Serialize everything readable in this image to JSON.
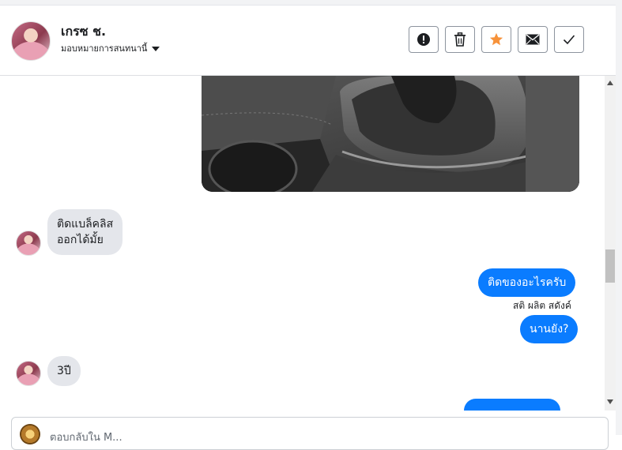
{
  "header": {
    "contact_name": "เกรซ ช.",
    "assign_label": "มอบหมายการสนทนานี้",
    "actions": [
      {
        "name": "report",
        "icon": "alert-circle-icon"
      },
      {
        "name": "delete",
        "icon": "trash-icon"
      },
      {
        "name": "star",
        "icon": "star-icon"
      },
      {
        "name": "mark-unread",
        "icon": "envelope-icon"
      },
      {
        "name": "done",
        "icon": "check-icon"
      }
    ],
    "colors": {
      "star": "#f7923a"
    }
  },
  "messages": [
    {
      "type": "image",
      "direction": "outgoing",
      "description_icon": "car-gear-shift-photo"
    },
    {
      "type": "text",
      "direction": "incoming",
      "text": "ติดแบล็คลิส\nออกได้มั้ย"
    },
    {
      "type": "text",
      "direction": "outgoing",
      "text": "ติดของอะไรครับ"
    },
    {
      "type": "sender",
      "text": "สติ ผลิต สดังค์"
    },
    {
      "type": "text",
      "direction": "outgoing",
      "text": "นานยัง?"
    },
    {
      "type": "text",
      "direction": "incoming",
      "text": "3ปี"
    }
  ],
  "composer": {
    "placeholder": "ตอบกลับใน M..."
  },
  "colors": {
    "outgoing_bubble": "#0a7cff",
    "incoming_bubble": "#e4e6eb"
  }
}
